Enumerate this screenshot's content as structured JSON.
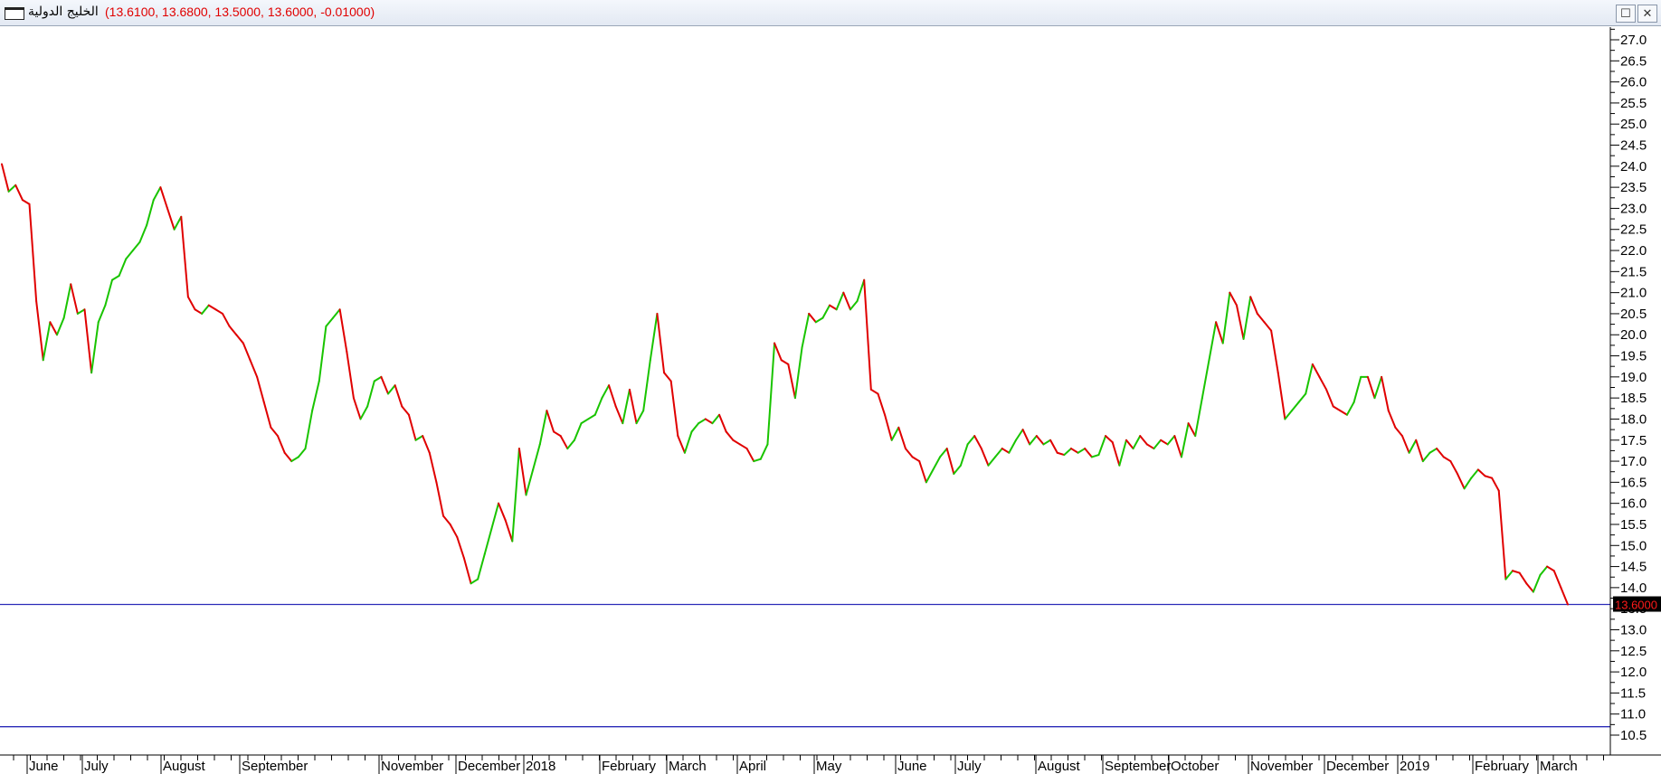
{
  "window": {
    "title_name": "الخليج الدولية",
    "title_values": "(13.6100, 13.6800, 13.5000, 13.6000, -0.01000)",
    "restore_glyph": "☐",
    "close_glyph": "✕"
  },
  "colors": {
    "up": "#19c400",
    "down": "#e00000",
    "hline": "#2b2bb8",
    "price_badge_bg": "#000000",
    "price_badge_text": "#ff1a1a"
  },
  "chart_data": {
    "type": "line",
    "title": "",
    "xlabel": "",
    "ylabel": "",
    "ylim": [
      10.2,
      27.3
    ],
    "y_ticks": [
      "10.5",
      "11.0",
      "11.5",
      "12.0",
      "12.5",
      "13.0",
      "13.5",
      "14.0",
      "14.5",
      "15.0",
      "15.5",
      "16.0",
      "16.5",
      "17.0",
      "17.5",
      "18.0",
      "18.5",
      "19.0",
      "19.5",
      "20.0",
      "20.5",
      "21.0",
      "21.5",
      "22.0",
      "22.5",
      "23.0",
      "23.5",
      "24.0",
      "24.5",
      "25.0",
      "25.5",
      "26.0",
      "26.5",
      "27.0"
    ],
    "x_labels": [
      "June",
      "July",
      "August",
      "September",
      "November",
      "December",
      "2018",
      "February",
      "March",
      "April",
      "May",
      "June",
      "July",
      "August",
      "September",
      "October",
      "November",
      "December",
      "2019",
      "February",
      "March"
    ],
    "last_price_label": "13.6000",
    "horizontal_lines": [
      13.6,
      10.7
    ],
    "series": [
      {
        "values": [
          24.05,
          23.4,
          23.55,
          23.2,
          23.1,
          20.8,
          19.4,
          20.3,
          20.0,
          20.4,
          21.2,
          20.5,
          20.6,
          19.1,
          20.3,
          20.7,
          21.3,
          21.4,
          21.8,
          22.0,
          22.2,
          22.6,
          23.2,
          23.5,
          23.0,
          22.5,
          22.8,
          20.9,
          20.6,
          20.5,
          20.7,
          20.6,
          20.5,
          20.2,
          20.0,
          19.8,
          19.4,
          19.0,
          18.4,
          17.8,
          17.6,
          17.2,
          17.0,
          17.1,
          17.3,
          18.2,
          18.9,
          20.2,
          20.4,
          20.6,
          19.6,
          18.5,
          18.0,
          18.3,
          18.9,
          19.0,
          18.6,
          18.8,
          18.3,
          18.1,
          17.5,
          17.6,
          17.2,
          16.5,
          15.7,
          15.5,
          15.2,
          14.7,
          14.1,
          14.2,
          14.8,
          15.4,
          16.0,
          15.6,
          15.1,
          17.3,
          16.2,
          16.8,
          17.4,
          18.2,
          17.7,
          17.6,
          17.3,
          17.5,
          17.9,
          18.0,
          18.1,
          18.5,
          18.8,
          18.3,
          17.9,
          18.7,
          17.9,
          18.2,
          19.4,
          20.5,
          19.1,
          18.9,
          17.6,
          17.2,
          17.7,
          17.9,
          18.0,
          17.9,
          18.1,
          17.7,
          17.5,
          17.4,
          17.3,
          17.0,
          17.05,
          17.4,
          19.8,
          19.4,
          19.3,
          18.5,
          19.7,
          20.5,
          20.3,
          20.4,
          20.7,
          20.6,
          21.0,
          20.6,
          20.8,
          21.3,
          18.7,
          18.6,
          18.1,
          17.5,
          17.8,
          17.3,
          17.1,
          17.0,
          16.5,
          16.8,
          17.1,
          17.3,
          16.7,
          16.9,
          17.4,
          17.6,
          17.3,
          16.9,
          17.1,
          17.3,
          17.2,
          17.5,
          17.75,
          17.4,
          17.6,
          17.4,
          17.5,
          17.2,
          17.15,
          17.3,
          17.2,
          17.3,
          17.1,
          17.15,
          17.6,
          17.45,
          16.9,
          17.5,
          17.3,
          17.6,
          17.4,
          17.3,
          17.5,
          17.4,
          17.6,
          17.1,
          17.9,
          17.6,
          18.5,
          19.4,
          20.3,
          19.8,
          21.0,
          20.7,
          19.9,
          20.9,
          20.5,
          20.3,
          20.1,
          19.1,
          18.0,
          18.2,
          18.4,
          18.6,
          19.3,
          19.0,
          18.7,
          18.3,
          18.2,
          18.1,
          18.4,
          19.0,
          19.0,
          18.5,
          19.0,
          18.2,
          17.8,
          17.6,
          17.2,
          17.5,
          17.0,
          17.2,
          17.3,
          17.1,
          17.0,
          16.7,
          16.35,
          16.6,
          16.8,
          16.65,
          16.6,
          16.3,
          14.2,
          14.4,
          14.35,
          14.1,
          13.9,
          14.3,
          14.5,
          14.4,
          14.0,
          13.6
        ]
      }
    ]
  }
}
